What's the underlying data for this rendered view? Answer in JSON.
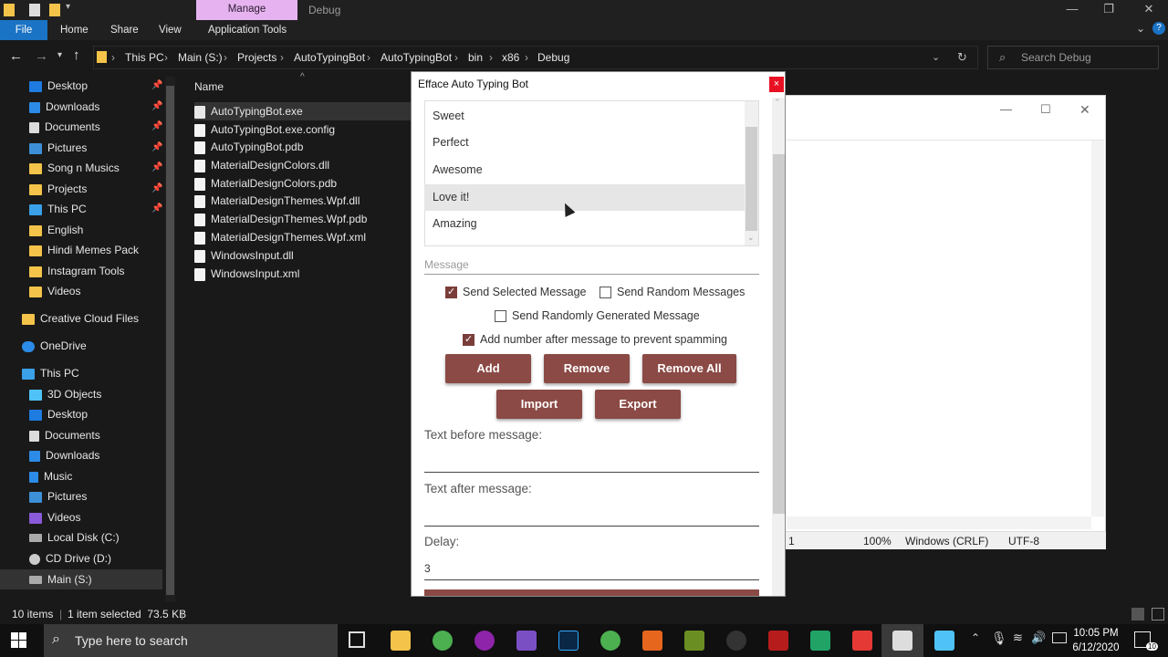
{
  "explorer": {
    "title_tab_manage": "Manage",
    "title_window": "Debug",
    "ribbon_tabs": [
      "File",
      "Home",
      "Share",
      "View",
      "Application Tools"
    ],
    "breadcrumb": [
      "This PC",
      "Main (S:)",
      "Projects",
      "AutoTypingBot",
      "AutoTypingBot",
      "bin",
      "x86",
      "Debug"
    ],
    "search_placeholder": "Search Debug",
    "column_name": "Name",
    "nav_items": [
      {
        "label": "Desktop",
        "pinned": true
      },
      {
        "label": "Downloads",
        "pinned": true
      },
      {
        "label": "Documents",
        "pinned": true
      },
      {
        "label": "Pictures",
        "pinned": true
      },
      {
        "label": "Song n Musics",
        "pinned": true
      },
      {
        "label": "Projects",
        "pinned": true
      },
      {
        "label": "This PC",
        "pinned": true
      },
      {
        "label": "English",
        "pinned": false
      },
      {
        "label": "Hindi Memes Pack",
        "pinned": false
      },
      {
        "label": "Instagram Tools",
        "pinned": false
      },
      {
        "label": "Videos",
        "pinned": false
      },
      {
        "label": "Creative Cloud Files",
        "pinned": false
      },
      {
        "label": "OneDrive",
        "pinned": false
      },
      {
        "label": "This PC",
        "pinned": false
      },
      {
        "label": "3D Objects",
        "pinned": false
      },
      {
        "label": "Desktop",
        "pinned": false
      },
      {
        "label": "Documents",
        "pinned": false
      },
      {
        "label": "Downloads",
        "pinned": false
      },
      {
        "label": "Music",
        "pinned": false
      },
      {
        "label": "Pictures",
        "pinned": false
      },
      {
        "label": "Videos",
        "pinned": false
      },
      {
        "label": "Local Disk (C:)",
        "pinned": false
      },
      {
        "label": "CD Drive (D:)",
        "pinned": false
      },
      {
        "label": "Main (S:)",
        "pinned": false
      }
    ],
    "files": [
      "AutoTypingBot.exe",
      "AutoTypingBot.exe.config",
      "AutoTypingBot.pdb",
      "MaterialDesignColors.dll",
      "MaterialDesignColors.pdb",
      "MaterialDesignThemes.Wpf.dll",
      "MaterialDesignThemes.Wpf.pdb",
      "MaterialDesignThemes.Wpf.xml",
      "WindowsInput.dll",
      "WindowsInput.xml"
    ],
    "status_items": "10 items",
    "status_selected": "1 item selected  73.5 KB"
  },
  "notepad": {
    "status": [
      "1",
      "100%",
      "Windows (CRLF)",
      "UTF-8"
    ]
  },
  "app": {
    "title": "Efface Auto Typing Bot",
    "close": "×",
    "messages": [
      "Sweet",
      "Perfect",
      "Awesome",
      "Love it!",
      "Amazing"
    ],
    "message_placeholder": "Message",
    "checkboxes": {
      "send_selected": {
        "label": "Send Selected Message",
        "checked": true
      },
      "send_random": {
        "label": "Send Random Messages",
        "checked": false
      },
      "send_generated": {
        "label": "Send Randomly Generated Message",
        "checked": false
      },
      "add_number": {
        "label": "Add number after message to prevent spamming",
        "checked": true
      }
    },
    "buttons": {
      "add": "Add",
      "remove": "Remove",
      "remove_all": "Remove All",
      "import": "Import",
      "export": "Export"
    },
    "text_before_label": "Text before message:",
    "text_after_label": "Text after message:",
    "delay_label": "Delay:",
    "delay_value": "3"
  },
  "taskbar": {
    "search_placeholder": "Type here to search",
    "time": "10:05 PM",
    "date": "6/12/2020",
    "notifications": "10"
  },
  "colors": {
    "accent_button": "#8b4a45",
    "file_tab": "#1a73c4",
    "manage_tab": "#e6b3f0"
  }
}
